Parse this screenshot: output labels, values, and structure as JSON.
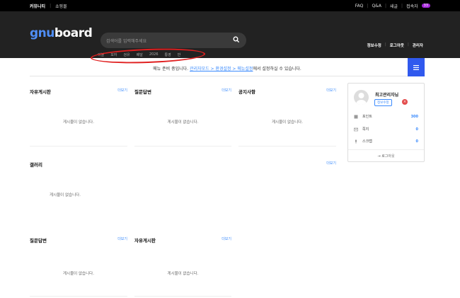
{
  "topbar": {
    "community": "커뮤니티",
    "shopping": "쇼핑몰",
    "faq": "FAQ",
    "qa": "Q&A",
    "new": "새글",
    "visitors": "접속자",
    "visitor_count": "33"
  },
  "header": {
    "logo_g": "gnu",
    "logo_rest": "board",
    "search_placeholder": "검색어를 입력해주세요",
    "hot_keywords": [
      "이블",
      "모자",
      "검유",
      "배달",
      "2026",
      "통영",
      "반"
    ],
    "user_links": [
      "정보수정",
      "로그아웃",
      "관리자"
    ]
  },
  "notice": {
    "prefix": "메뉴 준비 중입니다.",
    "link": "관리자모드 > 환경설정 > 메뉴설정",
    "suffix": "에서 설정하실 수 있습니다."
  },
  "boards": {
    "free": {
      "title": "자유게시판",
      "more": "더보기",
      "empty": "게시물이 없습니다."
    },
    "qa": {
      "title": "질문답변",
      "more": "더보기",
      "empty": "게시물이 없습니다."
    },
    "notice": {
      "title": "공지사항",
      "more": "더보기",
      "empty": "게시물이 없습니다."
    },
    "gallery": {
      "title": "갤러리",
      "more": "더보기",
      "empty": "게시물이 없습니다."
    },
    "qa2": {
      "title": "질문답변",
      "more": "더보기",
      "empty": "게시물이 없습니다."
    },
    "free2": {
      "title": "자유게시판",
      "more": "더보기",
      "empty": "게시물이 없습니다."
    }
  },
  "sidebar": {
    "name": "최고관리자님",
    "edit": "정보수정",
    "points_label": "포인트",
    "points_value": "300",
    "memo_label": "쪽지",
    "memo_value": "0",
    "scrap_label": "스크랩",
    "scrap_value": "0",
    "logout": "로그아웃"
  },
  "colors": {
    "accent": "#3059ee",
    "link": "#3a8afd",
    "badge": "#a323d8",
    "highlight_circle": "#e02020"
  }
}
